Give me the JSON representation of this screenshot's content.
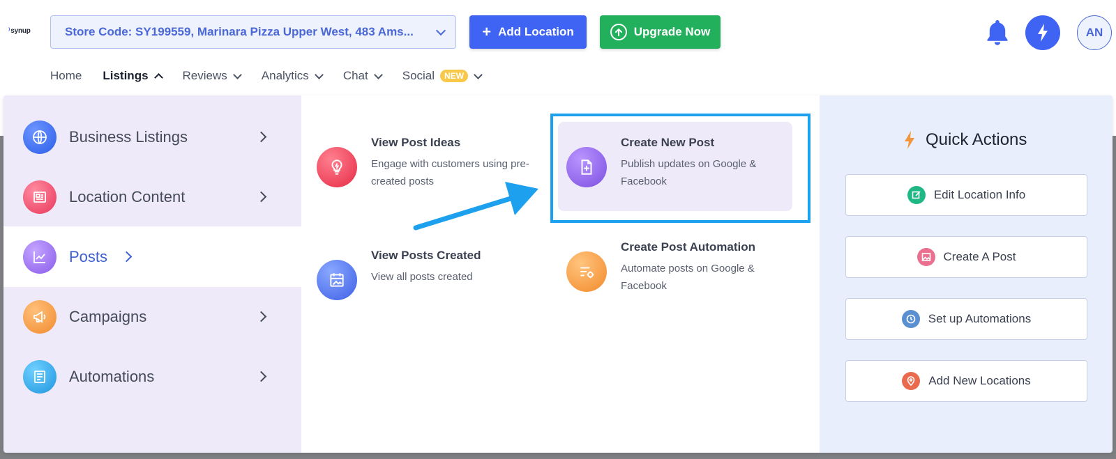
{
  "app": {
    "logo": "synup"
  },
  "header": {
    "store_select": "Store Code: SY199559, Marinara Pizza Upper West, 483 Ams...",
    "add_location": "Add Location",
    "upgrade_now": "Upgrade Now",
    "avatar_initials": "AN",
    "icons": [
      "bell-icon",
      "bolt-icon",
      "chevron-down-icon",
      "plus-icon",
      "arrow-up-circle-icon"
    ]
  },
  "nav": {
    "items": [
      {
        "label": "Home"
      },
      {
        "label": "Listings",
        "active": true
      },
      {
        "label": "Reviews"
      },
      {
        "label": "Analytics"
      },
      {
        "label": "Chat"
      },
      {
        "label": "Social",
        "badge": "NEW"
      }
    ]
  },
  "menu": {
    "left": [
      {
        "label": "Business Listings",
        "icon": "globe-icon",
        "color": "#3b6df6"
      },
      {
        "label": "Location Content",
        "icon": "id-card-icon",
        "color": "#f0506e"
      },
      {
        "label": "Posts",
        "icon": "chart-line-icon",
        "color": "#9b6ff0",
        "active": true
      },
      {
        "label": "Campaigns",
        "icon": "megaphone-icon",
        "color": "#f2963d"
      },
      {
        "label": "Automations",
        "icon": "document-icon",
        "color": "#2ba6e8"
      }
    ],
    "cards": [
      {
        "title": "View Post Ideas",
        "desc": "Engage with customers using pre-created posts",
        "icon": "lightbulb-icon"
      },
      {
        "title": "Create New Post",
        "desc": "Publish updates on Google & Facebook",
        "icon": "file-plus-icon"
      },
      {
        "title": "View Posts Created",
        "desc": "View all posts created",
        "icon": "calendar-image-icon"
      },
      {
        "title": "Create Post Automation",
        "desc": "Automate posts on Google & Facebook",
        "icon": "automation-gear-icon"
      }
    ],
    "quick_actions": {
      "title": "Quick Actions",
      "items": [
        {
          "label": "Edit Location Info",
          "icon": "edit-icon",
          "color": "#1fb884"
        },
        {
          "label": "Create A Post",
          "icon": "image-icon",
          "color": "#e9708f"
        },
        {
          "label": "Set up Automations",
          "icon": "clock-icon",
          "color": "#5a8fd1"
        },
        {
          "label": "Add New Locations",
          "icon": "map-pin-icon",
          "color": "#ea6a4e"
        }
      ]
    }
  },
  "colors": {
    "primary": "#3f63f2",
    "success": "#23b05c",
    "highlight": "#1da1ee",
    "badge": "#f7c84a"
  }
}
